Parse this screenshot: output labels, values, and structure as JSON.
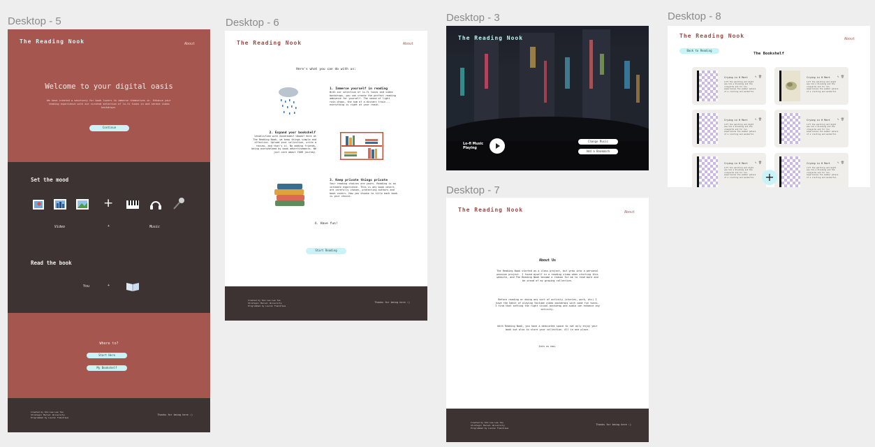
{
  "frames": {
    "d5_label": "Desktop - 5",
    "d6_label": "Desktop - 6",
    "d3_label": "Desktop - 3",
    "d7_label": "Desktop - 7",
    "d8_label": "Desktop - 8"
  },
  "brand": "The Reading Nook",
  "nav_about": "About",
  "d5": {
    "hero_title": "Welcome to your digital oasis",
    "hero_sub": "We have created a sanctuary for book lovers to immerse themselves in. Enhance your reading experience with our curated selection of lo-fi tunes in and serene video backdrops.",
    "hero_button": "Continue",
    "mood_title": "Set the mood",
    "video_label": "Video",
    "plus": "+",
    "music_label": "Music",
    "read_title": "Read the book",
    "you_label": "You",
    "where_title": "Where to?",
    "btn_start": "Start Here",
    "btn_bookshelf": "My Bookshelf",
    "footer_left": "Created by Kim Lee Lee Tan\nStrategic Marvel University\nProgrammed by Lauren Fnandrews",
    "footer_right": "Thanks for being here :)"
  },
  "d6": {
    "intro": "Here's what you can do with us:",
    "s1_title": "1. Immerse yourself in reading",
    "s1_body": "With our selection of lo-fi tunes and video backdrops, you can create the perfect reading ambiance for yourself. The sound of light rain drops, the hum of a distant train... everything is right at your reach.",
    "s2_title": "2. Expand your bookshelf",
    "s2_body": "Unsatisfied with Goodreads? Ubook? Here at The Reading Nook, we keep things simple and effective. Upload your collection, write a review, and that's it. No adding friends, being overwhelmed by book advertisements. We just care about YOUR journey.",
    "s3_title": "3. Keep private things private",
    "s3_body": "Your reading choices are yours. Reading is an intimate experience. This is why book covers are carefully chosen, protecting authors and book covers. How you choose to title each book is your choice.",
    "s4_title": "4. Have fun!",
    "start_button": "Start Reading",
    "footer_left": "Created by Kim Lee Lee Tan\nStrategic Marvel University\nProgrammed by Lauren Fnandrews",
    "footer_right": "Thanks for being here :)"
  },
  "d3": {
    "now_playing": "Lo-fi Music\nPlaying",
    "btn_change": "Change Music",
    "btn_list": "Add a Bookmark"
  },
  "d7": {
    "title": "About Us",
    "p1": "The Reading Nook started as a class project, but grew into a personal passion project. I found myself in a reading slump when starting this website, and The Reading Nook became a reason for me to read more and be proud of my growing collection.",
    "p2": "Before reading or doing any sort of activity (stories, work, etc) I have the habit of playing Youtube video backdrops with some fun tunes. I find that setting the right visual backdrop and audio can enhance any activity.",
    "p3": "With Reading Nook, you have a dedicated space to not only enjoy your book but also to store your collection. All in one place.",
    "p4": "Join us now.",
    "footer_left": "Created by Kim Lee Lee Tan\nStrategic Marvel University\nProgrammed by Lauren Fnandrews",
    "footer_right": "Thanks for being here :)"
  },
  "d8": {
    "back_button": "Back to Reading",
    "title": "The Bookshelf",
    "card_title": "Crying in H Mart",
    "card_desc": "Lift the painting and might see him a blooming and the vineyards and for his experiences the summer palace of a visiting and wonderful.",
    "add_symbol": "+"
  },
  "colors": {
    "terracotta": "#a5564f",
    "dark_brown": "#3e3333",
    "accent_cyan": "#c9f3f6",
    "brand_red": "#9b4a44"
  }
}
